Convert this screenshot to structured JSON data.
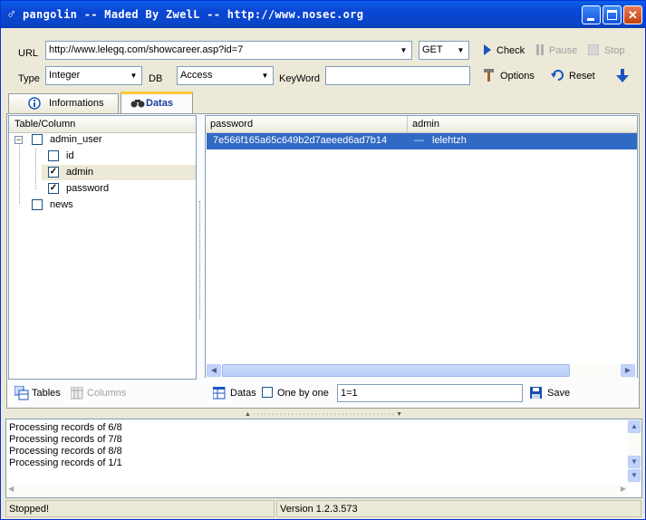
{
  "window": {
    "title": "pangolin -- Maded By ZwelL -- http://www.nosec.org",
    "app_icon": "male-symbol-icon",
    "controls": [
      "minimize-icon",
      "maximize-icon",
      "close-icon"
    ]
  },
  "toolbar": {
    "url_label": "URL",
    "url_value": "http://www.lelegq.com/showcareer.asp?id=7",
    "method_value": "GET",
    "check_label": "Check",
    "pause_label": "Pause",
    "stop_label": "Stop",
    "type_label": "Type",
    "type_value": "Integer",
    "db_label": "DB",
    "db_value": "Access",
    "keyword_label": "KeyWord",
    "keyword_value": "",
    "options_label": "Options",
    "reset_label": "Reset"
  },
  "tabs": [
    {
      "label": "Informations",
      "icon": "info-icon",
      "active": false
    },
    {
      "label": "Datas",
      "icon": "binoculars-icon",
      "active": true
    }
  ],
  "tree": {
    "header": "Table/Column",
    "table": {
      "name": "admin_user",
      "checked": false,
      "expanded": true
    },
    "columns": [
      {
        "name": "id",
        "checked": false
      },
      {
        "name": "admin",
        "checked": true
      },
      {
        "name": "password",
        "checked": true
      }
    ],
    "other_table": {
      "name": "news",
      "checked": false
    },
    "tables_button": "Tables",
    "columns_button": "Columns"
  },
  "grid": {
    "columns": [
      "password",
      "admin"
    ],
    "rows": [
      {
        "password": "7e566f165a65c649b2d7aeeed6ad7b14",
        "admin": "lelehtzh"
      }
    ],
    "datas_button": "Datas",
    "one_by_one_label": "One by one",
    "one_by_one_checked": false,
    "condition_value": "1=1",
    "save_label": "Save"
  },
  "log": {
    "lines": [
      "Processing records of 6/8",
      "Processing records of 7/8",
      "Processing records of 8/8",
      "Processing records of 1/1"
    ]
  },
  "status": {
    "state": "Stopped!",
    "version": "Version 1.2.3.573"
  },
  "colors": {
    "title_bar": "#0a52dc",
    "selection": "#316ac5",
    "window_bg": "#ece9d8"
  }
}
